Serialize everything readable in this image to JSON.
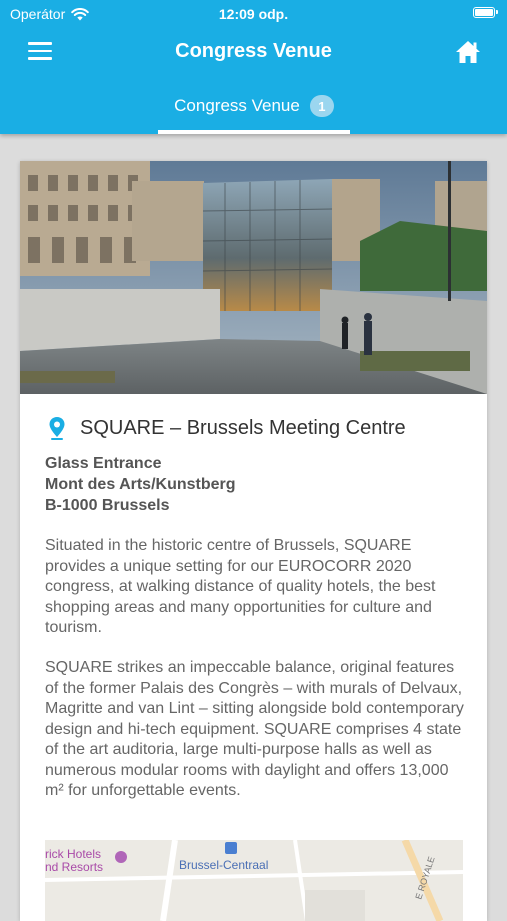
{
  "status_bar": {
    "carrier": "Operátor",
    "time": "12:09 odp."
  },
  "nav": {
    "title": "Congress Venue"
  },
  "tab": {
    "label": "Congress Venue",
    "badge": "1"
  },
  "venue": {
    "name": "SQUARE – Brussels Meeting Centre",
    "address_lines": [
      "Glass Entrance",
      "Mont des Arts/Kunstberg",
      "B-1000 Brussels"
    ],
    "paragraphs": [
      "Situated in the historic centre of Brussels, SQUARE provides a unique setting for our EUROCORR 2020 congress, at walking distance of quality hotels, the best shopping areas and many opportunities for culture and tourism.",
      "SQUARE strikes an impeccable balance, original features of the former Palais des Congrès – with murals of Delvaux, Magritte and van Lint – sitting alongside bold contemporary design and hi-tech equipment. SQUARE comprises 4 state of the art auditoria, large multi-purpose halls as well as numerous modular rooms with daylight and offers 13,000 m² for unforgettable events."
    ]
  },
  "map": {
    "labels": [
      "rick Hotels",
      "nd Resorts",
      "Brussel-Centraal",
      "E ROYALE"
    ]
  },
  "colors": {
    "primary": "#1aaee4",
    "badge": "#9bd6ef"
  }
}
